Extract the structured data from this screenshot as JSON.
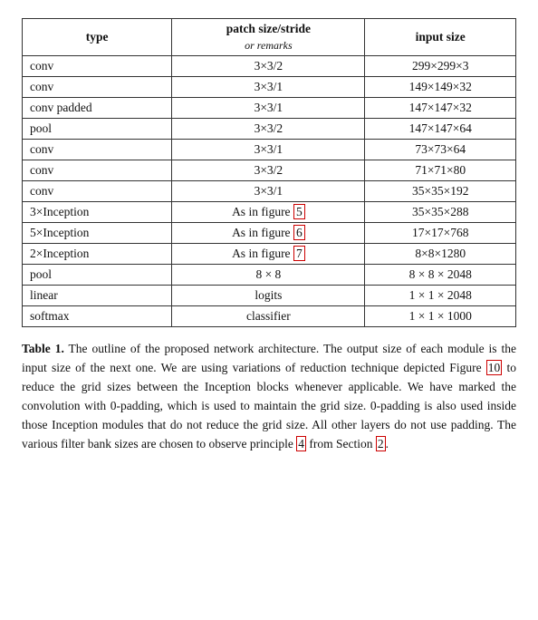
{
  "table": {
    "headers": {
      "col1": "type",
      "col2_top": "patch size/stride",
      "col2_bottom": "or remarks",
      "col3": "input size"
    },
    "rows": [
      {
        "type": "conv",
        "patch": "3×3/2",
        "input": "299×299×3"
      },
      {
        "type": "conv",
        "patch": "3×3/1",
        "input": "149×149×32"
      },
      {
        "type": "conv padded",
        "patch": "3×3/1",
        "input": "147×147×32"
      },
      {
        "type": "pool",
        "patch": "3×3/2",
        "input": "147×147×64"
      },
      {
        "type": "conv",
        "patch": "3×3/1",
        "input": "73×73×64"
      },
      {
        "type": "conv",
        "patch": "3×3/2",
        "input": "71×71×80"
      },
      {
        "type": "conv",
        "patch": "3×3/1",
        "input": "35×35×192"
      },
      {
        "type": "3×Inception",
        "patch": "As in figure 5",
        "input": "35×35×288"
      },
      {
        "type": "5×Inception",
        "patch": "As in figure 6",
        "input": "17×17×768"
      },
      {
        "type": "2×Inception",
        "patch": "As in figure 7",
        "input": "8×8×1280"
      },
      {
        "type": "pool",
        "patch": "8 × 8",
        "input": "8 × 8 × 2048"
      },
      {
        "type": "linear",
        "patch": "logits",
        "input": "1 × 1 × 2048"
      },
      {
        "type": "softmax",
        "patch": "classifier",
        "input": "1 × 1 × 1000"
      }
    ],
    "highlighted_rows": [
      7,
      8,
      9
    ]
  },
  "caption": {
    "label": "Table 1.",
    "text": " The outline of the proposed network architecture.  The output size of each module is the input size of the next one.  We are using variations of reduction technique depicted Figure ",
    "link1": "10",
    "text2": " to reduce the grid sizes between the Inception blocks whenever applicable.  We have marked the convolution with 0-padding, which is used to maintain the grid size.  0-padding is also used inside those Inception modules that do not reduce the grid size.  All other layers do not use padding.  The various filter bank sizes are chosen to observe principle ",
    "link2": "4",
    "text3": " from Section ",
    "link3": "2",
    "text4": "."
  }
}
